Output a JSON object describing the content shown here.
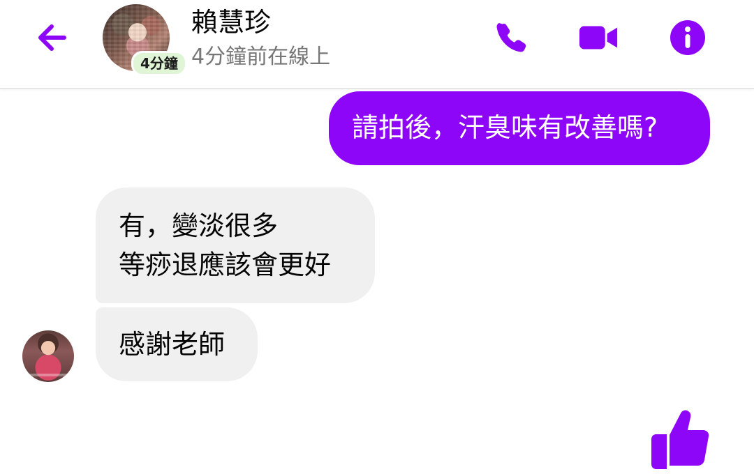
{
  "header": {
    "contact_name": "賴慧珍",
    "active_badge": "4分鐘",
    "status": "4分鐘前在線上"
  },
  "messages": [
    {
      "direction": "outgoing",
      "lines": [
        "請拍後，汗臭味有改善嗎?"
      ]
    },
    {
      "direction": "incoming",
      "lines": [
        "有，變淡很多",
        "等痧退應該會更好"
      ]
    },
    {
      "direction": "incoming",
      "lines": [
        "感謝老師"
      ]
    }
  ],
  "icons": {
    "back": "back-arrow-icon",
    "call": "phone-icon",
    "video": "video-camera-icon",
    "info": "info-icon",
    "like": "thumbs-up-icon"
  },
  "colors": {
    "accent": "#8d06f7",
    "incoming_bubble": "#f0f0f0",
    "badge_bg": "#dff5d5",
    "outgoing_text": "#ffffff",
    "status_text": "#777777"
  }
}
